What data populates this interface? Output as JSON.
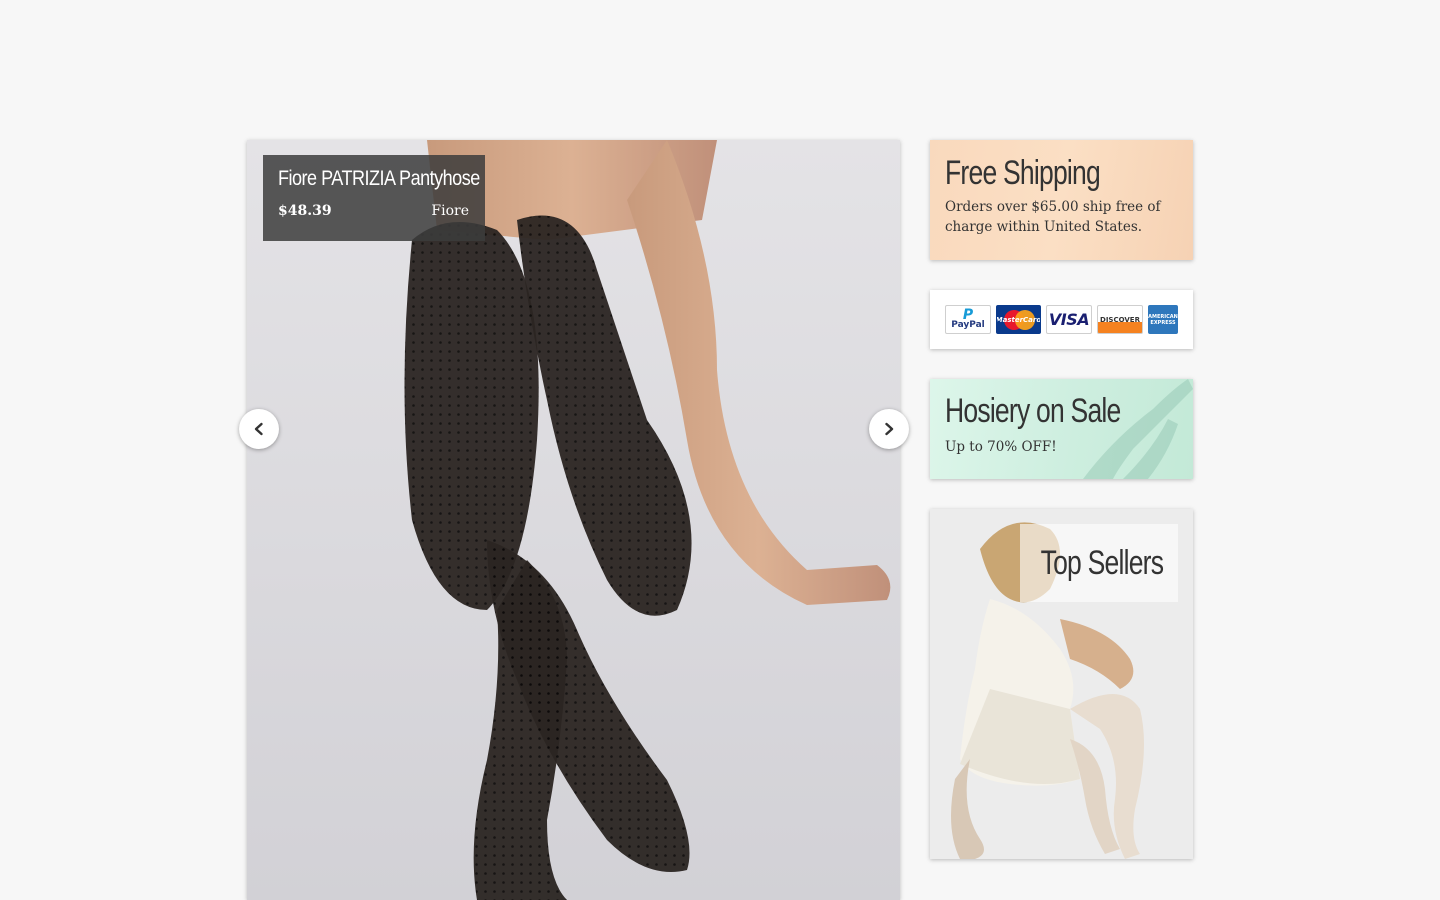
{
  "slider": {
    "caption": {
      "title": "Fiore PATRIZIA Pantyhose",
      "price": "$48.39",
      "brand": "Fiore"
    },
    "prev_icon": "chevron-left-icon",
    "next_icon": "chevron-right-icon"
  },
  "shipping_banner": {
    "heading": "Free Shipping",
    "text": "Orders over $65.00 ship free of charge within United States."
  },
  "payments": {
    "cards": [
      {
        "name": "PayPal",
        "top": "P",
        "bottom": "PayPal"
      },
      {
        "name": "MasterCard"
      },
      {
        "name": "VISA"
      },
      {
        "name": "DISCOVER"
      },
      {
        "name": "AMERICAN EXPRESS"
      }
    ]
  },
  "sale_banner": {
    "heading": "Hosiery on Sale",
    "text": "Up to 70% OFF!"
  },
  "top_sellers": {
    "heading": "Top Sellers"
  },
  "colors": {
    "page_bg": "#f7f7f7",
    "caption_bg": "#3c3c3c",
    "shipping_bg": "#f9d9bd",
    "sale_bg": "#cdeedf"
  }
}
